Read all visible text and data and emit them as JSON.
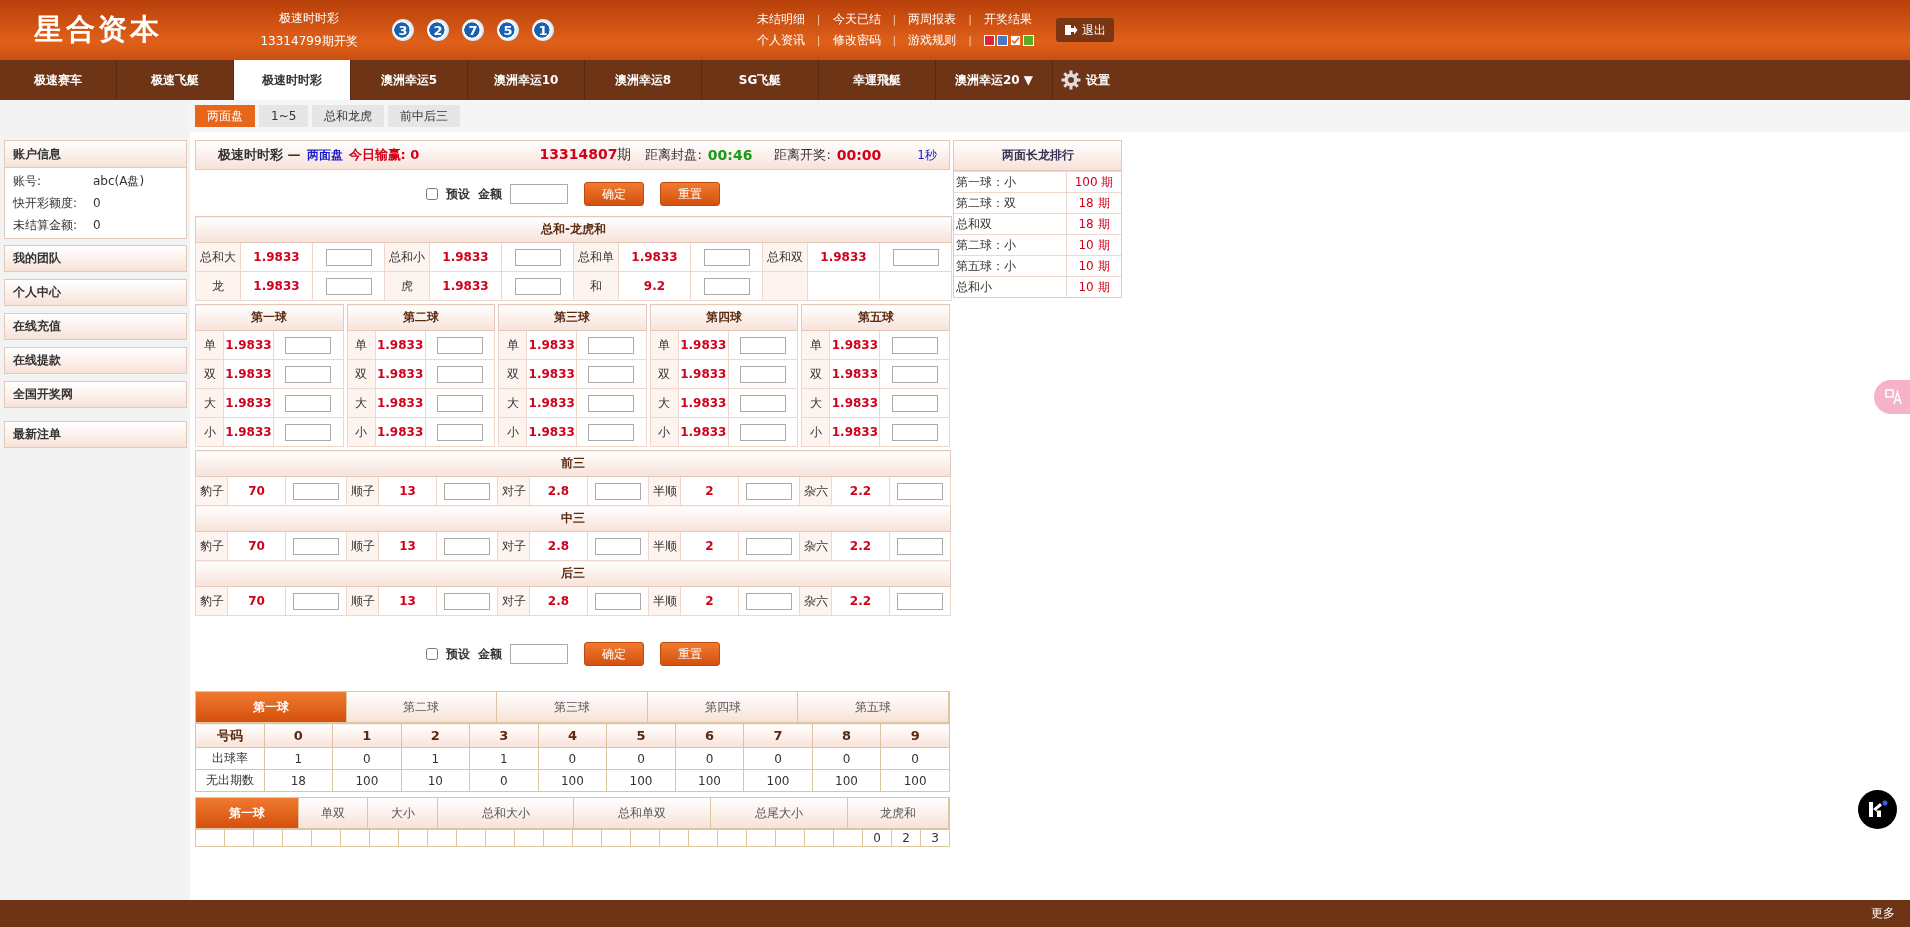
{
  "header": {
    "logo": "星合资本",
    "game": "极速时时彩",
    "draw": "13314799期开奖",
    "balls": [
      "3",
      "2",
      "7",
      "5",
      "1"
    ],
    "links_row1": [
      {
        "kind": "link",
        "text": "未结明细"
      },
      {
        "kind": "sep",
        "text": "|"
      },
      {
        "kind": "link",
        "text": "今天已结"
      },
      {
        "kind": "sep",
        "text": "|"
      },
      {
        "kind": "link",
        "text": "两周报表"
      },
      {
        "kind": "sep",
        "text": "|"
      },
      {
        "kind": "link",
        "text": "开奖结果"
      }
    ],
    "links_row2": [
      {
        "kind": "link",
        "text": "个人资讯"
      },
      {
        "kind": "sep",
        "text": "|"
      },
      {
        "kind": "link",
        "text": "修改密码"
      },
      {
        "kind": "sep",
        "text": "|"
      },
      {
        "kind": "link",
        "text": "游戏规则"
      },
      {
        "kind": "sep",
        "text": "|"
      }
    ],
    "themes": [
      {
        "color": "#d9263a",
        "selected": false
      },
      {
        "color": "#4a78c8",
        "selected": false
      },
      {
        "color": "#e8661a",
        "selected": true
      },
      {
        "color": "#5aaa2a",
        "selected": false
      }
    ],
    "logout": "退出"
  },
  "nav": {
    "tabs": [
      {
        "label": "极速赛车",
        "selected": false
      },
      {
        "label": "极速飞艇",
        "selected": false
      },
      {
        "label": "极速时时彩",
        "selected": true
      },
      {
        "label": "澳洲幸运5",
        "selected": false
      },
      {
        "label": "澳洲幸运10",
        "selected": false
      },
      {
        "label": "澳洲幸运8",
        "selected": false
      },
      {
        "label": "SG飞艇",
        "selected": false
      },
      {
        "label": "幸運飛艇",
        "selected": false
      },
      {
        "label": "澳洲幸运20 ▼",
        "selected": false
      }
    ],
    "settings": "设置"
  },
  "sub_tabs": [
    {
      "label": "两面盘",
      "selected": true
    },
    {
      "label": "1~5",
      "selected": false
    },
    {
      "label": "总和龙虎",
      "selected": false
    },
    {
      "label": "前中后三",
      "selected": false
    }
  ],
  "sidebar": {
    "account": {
      "title": "账户信息",
      "rows": [
        {
          "label": "账号:",
          "value": "abc(A盘)"
        },
        {
          "label": "快开彩额度:",
          "value": "0"
        },
        {
          "label": "未结算金额:",
          "value": "0"
        }
      ]
    },
    "groups": [
      [
        "我的团队",
        "个人中心",
        "在线充值",
        "在线提款",
        "全国开奖网"
      ],
      [
        "最新注单"
      ]
    ]
  },
  "info": {
    "game": "极速时时彩 —",
    "mode": "两面盘",
    "today": "今日输赢: 0",
    "period": "**13314807**期",
    "close_label": "距离封盘:",
    "close_time": "00:46",
    "open_label": "距离开奖:",
    "open_time": "00:00",
    "refresh": "1秒"
  },
  "preset_top": {
    "checked": false,
    "label": "预设",
    "amount_label": "金额",
    "confirm": "确定",
    "reset": "重置"
  },
  "sum_table": {
    "title": "总和-龙虎和",
    "rows": [
      [
        {
          "label": "总和大",
          "odds": "1.9833"
        },
        {
          "label": "总和小",
          "odds": "1.9833"
        },
        {
          "label": "总和单",
          "odds": "1.9833"
        },
        {
          "label": "总和双",
          "odds": "1.9833"
        }
      ],
      [
        {
          "label": "龙",
          "odds": "1.9833"
        },
        {
          "label": "虎",
          "odds": "1.9833"
        },
        {
          "label": "和",
          "odds": "9.2"
        }
      ]
    ]
  },
  "balls": [
    {
      "title": "第一球",
      "rows": [
        {
          "label": "单",
          "odds": "1.9833"
        },
        {
          "label": "双",
          "odds": "1.9833"
        },
        {
          "label": "大",
          "odds": "1.9833"
        },
        {
          "label": "小",
          "odds": "1.9833"
        }
      ]
    },
    {
      "title": "第二球",
      "rows": [
        {
          "label": "单",
          "odds": "1.9833"
        },
        {
          "label": "双",
          "odds": "1.9833"
        },
        {
          "label": "大",
          "odds": "1.9833"
        },
        {
          "label": "小",
          "odds": "1.9833"
        }
      ]
    },
    {
      "title": "第三球",
      "rows": [
        {
          "label": "单",
          "odds": "1.9833"
        },
        {
          "label": "双",
          "odds": "1.9833"
        },
        {
          "label": "大",
          "odds": "1.9833"
        },
        {
          "label": "小",
          "odds": "1.9833"
        }
      ]
    },
    {
      "title": "第四球",
      "rows": [
        {
          "label": "单",
          "odds": "1.9833"
        },
        {
          "label": "双",
          "odds": "1.9833"
        },
        {
          "label": "大",
          "odds": "1.9833"
        },
        {
          "label": "小",
          "odds": "1.9833"
        }
      ]
    },
    {
      "title": "第五球",
      "rows": [
        {
          "label": "单",
          "odds": "1.9833"
        },
        {
          "label": "双",
          "odds": "1.9833"
        },
        {
          "label": "大",
          "odds": "1.9833"
        },
        {
          "label": "小",
          "odds": "1.9833"
        }
      ]
    }
  ],
  "groups": [
    {
      "title": "前三",
      "items": [
        {
          "label": "豹子",
          "odds": "70"
        },
        {
          "label": "顺子",
          "odds": "13"
        },
        {
          "label": "对子",
          "odds": "2.8"
        },
        {
          "label": "半顺",
          "odds": "2"
        },
        {
          "label": "杂六",
          "odds": "2.2"
        }
      ]
    },
    {
      "title": "中三",
      "items": [
        {
          "label": "豹子",
          "odds": "70"
        },
        {
          "label": "顺子",
          "odds": "13"
        },
        {
          "label": "对子",
          "odds": "2.8"
        },
        {
          "label": "半顺",
          "odds": "2"
        },
        {
          "label": "杂六",
          "odds": "2.2"
        }
      ]
    },
    {
      "title": "后三",
      "items": [
        {
          "label": "豹子",
          "odds": "70"
        },
        {
          "label": "顺子",
          "odds": "13"
        },
        {
          "label": "对子",
          "odds": "2.8"
        },
        {
          "label": "半顺",
          "odds": "2"
        },
        {
          "label": "杂六",
          "odds": "2.2"
        }
      ]
    }
  ],
  "preset_bottom": {
    "checked": false,
    "label": "预设",
    "amount_label": "金额",
    "confirm": "确定",
    "reset": "重置"
  },
  "stats": {
    "tabs": [
      {
        "label": "第一球",
        "selected": true
      },
      {
        "label": "第二球",
        "selected": false
      },
      {
        "label": "第三球",
        "selected": false
      },
      {
        "label": "第四球",
        "selected": false
      },
      {
        "label": "第五球",
        "selected": false
      }
    ],
    "header": "号码",
    "numbers": [
      "0",
      "1",
      "2",
      "3",
      "4",
      "5",
      "6",
      "7",
      "8",
      "9"
    ],
    "rows": [
      {
        "label": "出球率",
        "values": [
          "1",
          "0",
          "1",
          "1",
          "0",
          "0",
          "0",
          "0",
          "0",
          "0"
        ]
      },
      {
        "label": "无出期数",
        "values": [
          "18",
          "100",
          "10",
          "0",
          "100",
          "100",
          "100",
          "100",
          "100",
          "100"
        ]
      }
    ]
  },
  "trend": {
    "tabs": [
      {
        "label": "第一球",
        "selected": true
      },
      {
        "label": "单双",
        "selected": false
      },
      {
        "label": "大小",
        "selected": false
      },
      {
        "label": "总和大小",
        "selected": false
      },
      {
        "label": "总和单双",
        "selected": false
      },
      {
        "label": "总尾大小",
        "selected": false
      },
      {
        "label": "龙虎和",
        "selected": false
      }
    ],
    "cells": [
      "0",
      "2",
      "3"
    ]
  },
  "ranking": {
    "title": "两面长龙排行",
    "rows": [
      {
        "name": "第一球：小",
        "count": "100 期"
      },
      {
        "name": "第二球：双",
        "count": "18 期"
      },
      {
        "name": "总和双",
        "count": "18 期"
      },
      {
        "name": "第二球：小",
        "count": "10 期"
      },
      {
        "name": "第五球：小",
        "count": "10 期"
      },
      {
        "name": "总和小",
        "count": "10 期"
      }
    ]
  },
  "footer": {
    "more": "更多"
  }
}
